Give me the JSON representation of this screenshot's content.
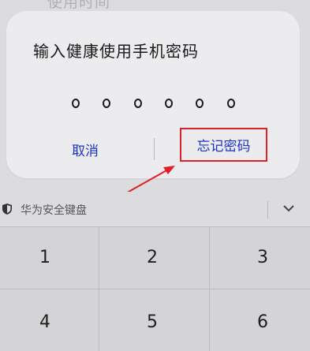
{
  "background_hint": "使用时间",
  "dialog": {
    "title": "输入健康使用手机密码",
    "pin_length": 6,
    "cancel_label": "取消",
    "forgot_label": "忘记密码"
  },
  "keyboard": {
    "title": "华为安全键盘",
    "keys": [
      "1",
      "2",
      "3",
      "4",
      "5",
      "6"
    ]
  },
  "colors": {
    "accent": "#1d34c9",
    "highlight": "#e02027"
  },
  "icons": {
    "shield": "shield-icon",
    "collapse": "chevron-down-icon"
  }
}
